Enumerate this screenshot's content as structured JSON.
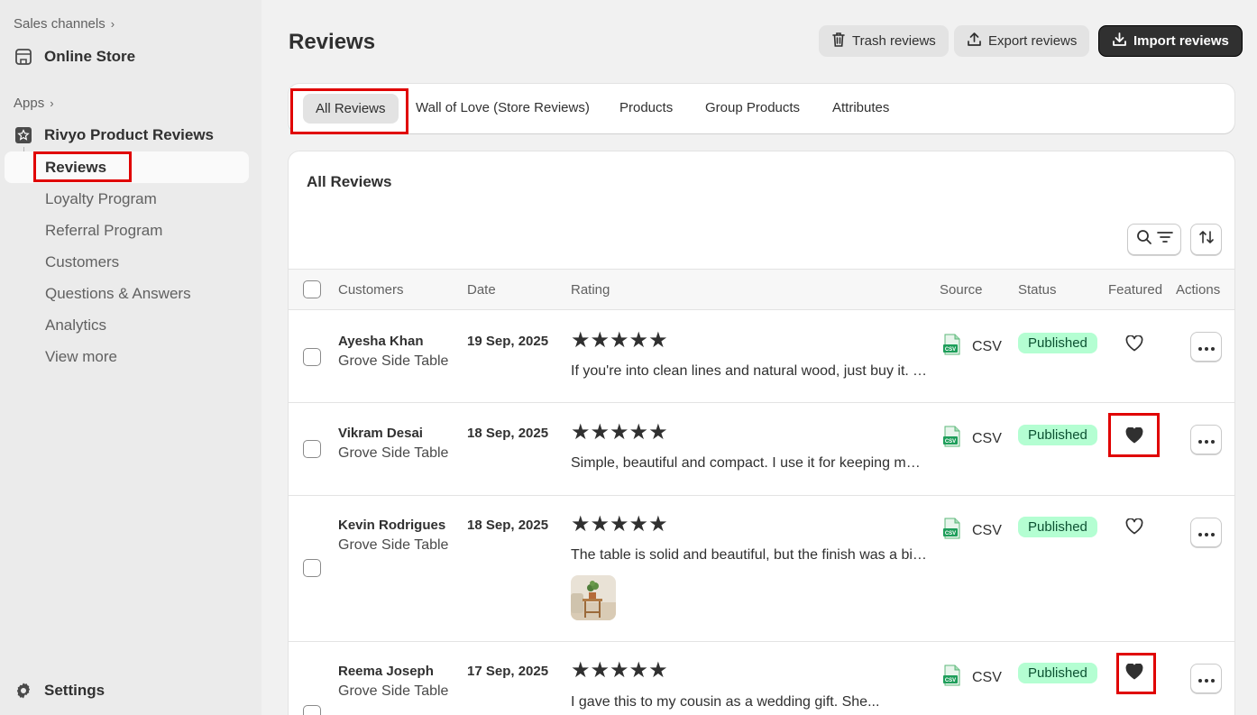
{
  "sidebar": {
    "sales_channels": "Sales channels",
    "online_store": "Online Store",
    "apps": "Apps",
    "app_name": "Rivyo Product Reviews",
    "items": [
      {
        "label": "Reviews",
        "active": true
      },
      {
        "label": "Loyalty Program"
      },
      {
        "label": "Referral Program"
      },
      {
        "label": "Customers"
      },
      {
        "label": "Questions & Answers"
      },
      {
        "label": "Analytics"
      },
      {
        "label": "View more"
      }
    ],
    "settings": "Settings"
  },
  "header": {
    "title": "Reviews",
    "trash_label": "Trash reviews",
    "export_label": "Export reviews",
    "import_label": "Import reviews"
  },
  "tabs": [
    {
      "label": "All Reviews",
      "active": true
    },
    {
      "label": "Wall of Love (Store Reviews)"
    },
    {
      "label": "Products"
    },
    {
      "label": "Group Products"
    },
    {
      "label": "Attributes"
    }
  ],
  "card": {
    "title": "All Reviews",
    "columns": {
      "customers": "Customers",
      "date": "Date",
      "rating": "Rating",
      "source": "Source",
      "status": "Status",
      "featured": "Featured",
      "actions": "Actions"
    },
    "rows": [
      {
        "name": "Ayesha Khan",
        "product": "Grove Side Table",
        "date": "19 Sep, 2025",
        "stars": "★★★★★",
        "rating": 5,
        "review": "If you're into clean lines and natural wood, just buy it. This table looks great in my living room.",
        "source": "CSV",
        "status": "Published",
        "featured": false
      },
      {
        "name": "Vikram Desai",
        "product": "Grove Side Table",
        "date": "18 Sep, 2025",
        "stars": "★★★★★",
        "rating": 5,
        "review": "Simple, beautiful and compact. I use it for keeping my plants and books next to the sofa.",
        "source": "CSV",
        "status": "Published",
        "featured": true
      },
      {
        "name": "Kevin Rodrigues",
        "product": "Grove Side Table",
        "date": "18 Sep, 2025",
        "stars": "★★★★★",
        "rating": 5,
        "review": "The table is solid and beautiful, but the finish was a bit uneven on one of the legs.",
        "source": "CSV",
        "status": "Published",
        "featured": false
      },
      {
        "name": "Reema Joseph",
        "product": "Grove Side Table",
        "date": "17 Sep, 2025",
        "stars": "★★★★★",
        "rating": 5,
        "review": "I gave this to my cousin as a wedding gift. She...",
        "source": "CSV",
        "status": "Published",
        "featured": true
      }
    ]
  },
  "colors": {
    "highlight": "#e00000",
    "badge_bg": "#b4fed2",
    "badge_text": "#0c5132",
    "primary_button": "#303030"
  }
}
